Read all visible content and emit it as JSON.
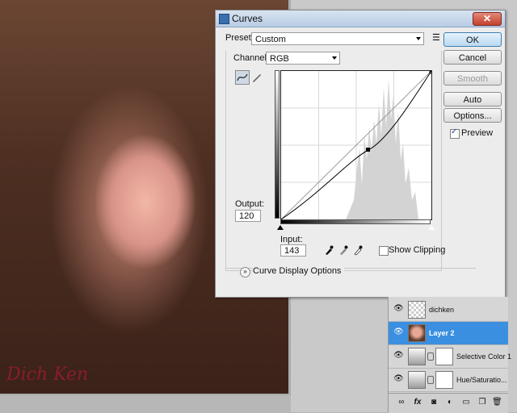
{
  "dialog": {
    "title": "Curves",
    "close_label": "✕",
    "preset_label": "Preset:",
    "preset_value": "Custom",
    "channel_label": "Channel:",
    "channel_value": "RGB",
    "output_label": "Output:",
    "output_value": "120",
    "input_label": "Input:",
    "input_value": "143",
    "show_clipping_label": "Show Clipping",
    "curve_display_label": "Curve Display Options",
    "buttons": {
      "ok": "OK",
      "cancel": "Cancel",
      "smooth": "Smooth",
      "auto": "Auto",
      "options": "Options..."
    },
    "preview_label": "Preview",
    "preview_checked": true,
    "show_clipping_checked": false
  },
  "curve": {
    "control_point": [
      143,
      120
    ],
    "histogram_note_colors": {
      "curve": "#000000",
      "diagonal": "#9a9a9a",
      "histogram": "#d3d3d3"
    }
  },
  "layers": [
    {
      "name": "dichken",
      "thumb": "checker",
      "selected": false
    },
    {
      "name": "Layer 2",
      "thumb": "face",
      "selected": true
    },
    {
      "name": "Selective Color 1",
      "thumb": "adj",
      "selected": false
    },
    {
      "name": "Hue/Saturatio...",
      "thumb": "adj",
      "selected": false
    }
  ],
  "photo_watermark": "Dich Ken",
  "icons": [
    "curve-tool-icon",
    "pencil-tool-icon",
    "preset-menu-icon",
    "black-eyedropper-icon",
    "gray-eyedropper-icon",
    "white-eyedropper-icon",
    "expand-icon",
    "eye-icon",
    "link-icon",
    "fx-icon",
    "mask-icon",
    "adjustment-icon",
    "folder-icon",
    "new-layer-icon",
    "trash-icon"
  ]
}
